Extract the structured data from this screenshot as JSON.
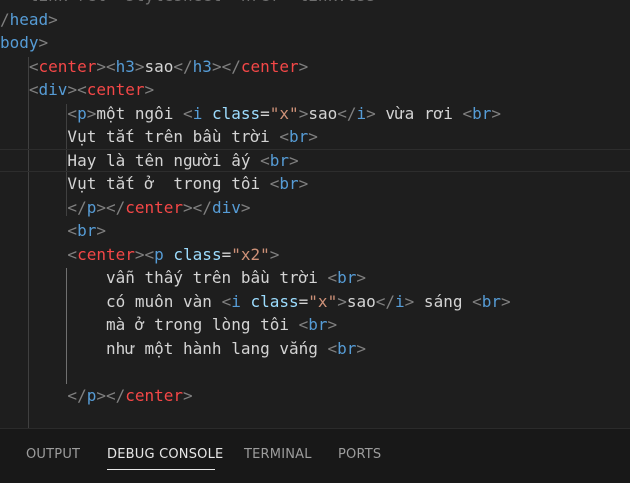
{
  "editor": {
    "lines": [
      [
        {
          "c": "cut",
          "t": "  <link rel=\"stylesheet\" href=\"link.css\">"
        }
      ],
      [
        {
          "c": "gray",
          "t": "/"
        },
        {
          "c": "tag",
          "t": "head"
        },
        {
          "c": "gray",
          "t": ">"
        }
      ],
      [
        {
          "c": "tag",
          "t": "body"
        },
        {
          "c": "gray",
          "t": ">"
        }
      ],
      [
        {
          "c": "gray",
          "t": "   <"
        },
        {
          "c": "red",
          "t": "center"
        },
        {
          "c": "gray",
          "t": "><"
        },
        {
          "c": "tag",
          "t": "h3"
        },
        {
          "c": "gray",
          "t": ">"
        },
        {
          "c": "txt",
          "t": "sao"
        },
        {
          "c": "gray",
          "t": "</"
        },
        {
          "c": "tag",
          "t": "h3"
        },
        {
          "c": "gray",
          "t": "></"
        },
        {
          "c": "red",
          "t": "center"
        },
        {
          "c": "gray",
          "t": ">"
        }
      ],
      [
        {
          "c": "gray",
          "t": "   <"
        },
        {
          "c": "tag",
          "t": "div"
        },
        {
          "c": "gray",
          "t": "><"
        },
        {
          "c": "red",
          "t": "center"
        },
        {
          "c": "gray",
          "t": ">"
        }
      ],
      [
        {
          "c": "gray",
          "t": "       <"
        },
        {
          "c": "tag",
          "t": "p"
        },
        {
          "c": "gray",
          "t": ">"
        },
        {
          "c": "txt",
          "t": "một ngôi "
        },
        {
          "c": "gray",
          "t": "<"
        },
        {
          "c": "tag",
          "t": "i"
        },
        {
          "c": "txt",
          "t": " "
        },
        {
          "c": "attr",
          "t": "class"
        },
        {
          "c": "txt",
          "t": "="
        },
        {
          "c": "str",
          "t": "\"x\""
        },
        {
          "c": "gray",
          "t": ">"
        },
        {
          "c": "txt",
          "t": "sao"
        },
        {
          "c": "gray",
          "t": "</"
        },
        {
          "c": "tag",
          "t": "i"
        },
        {
          "c": "gray",
          "t": ">"
        },
        {
          "c": "txt",
          "t": " vừa rơi "
        },
        {
          "c": "gray",
          "t": "<"
        },
        {
          "c": "tag",
          "t": "br"
        },
        {
          "c": "gray",
          "t": ">"
        }
      ],
      [
        {
          "c": "txt",
          "t": "       Vụt tắt trên bầu trời "
        },
        {
          "c": "gray",
          "t": "<"
        },
        {
          "c": "tag",
          "t": "br"
        },
        {
          "c": "gray",
          "t": ">"
        }
      ],
      [
        {
          "c": "txt",
          "t": "       Hay là tên người ấy "
        },
        {
          "c": "gray",
          "t": "<"
        },
        {
          "c": "tag",
          "t": "br"
        },
        {
          "c": "gray",
          "t": ">"
        }
      ],
      [
        {
          "c": "txt",
          "t": "       Vụt tắt ở  trong tôi "
        },
        {
          "c": "gray",
          "t": "<"
        },
        {
          "c": "tag",
          "t": "br"
        },
        {
          "c": "gray",
          "t": ">"
        }
      ],
      [
        {
          "c": "gray",
          "t": "       </"
        },
        {
          "c": "tag",
          "t": "p"
        },
        {
          "c": "gray",
          "t": "></"
        },
        {
          "c": "red",
          "t": "center"
        },
        {
          "c": "gray",
          "t": "></"
        },
        {
          "c": "tag",
          "t": "div"
        },
        {
          "c": "gray",
          "t": ">"
        }
      ],
      [
        {
          "c": "gray",
          "t": "       <"
        },
        {
          "c": "tag",
          "t": "br"
        },
        {
          "c": "gray",
          "t": ">"
        }
      ],
      [
        {
          "c": "gray",
          "t": "       <"
        },
        {
          "c": "red",
          "t": "center"
        },
        {
          "c": "gray",
          "t": "><"
        },
        {
          "c": "tag",
          "t": "p"
        },
        {
          "c": "txt",
          "t": " "
        },
        {
          "c": "attr",
          "t": "class"
        },
        {
          "c": "txt",
          "t": "="
        },
        {
          "c": "str",
          "t": "\"x2\""
        },
        {
          "c": "gray",
          "t": ">"
        }
      ],
      [
        {
          "c": "txt",
          "t": "           vẫn thấy trên bầu trời "
        },
        {
          "c": "gray",
          "t": "<"
        },
        {
          "c": "tag",
          "t": "br"
        },
        {
          "c": "gray",
          "t": ">"
        }
      ],
      [
        {
          "c": "txt",
          "t": "           có muôn vàn "
        },
        {
          "c": "gray",
          "t": "<"
        },
        {
          "c": "tag",
          "t": "i"
        },
        {
          "c": "txt",
          "t": " "
        },
        {
          "c": "attr",
          "t": "class"
        },
        {
          "c": "txt",
          "t": "="
        },
        {
          "c": "str",
          "t": "\"x\""
        },
        {
          "c": "gray",
          "t": ">"
        },
        {
          "c": "txt",
          "t": "sao"
        },
        {
          "c": "gray",
          "t": "</"
        },
        {
          "c": "tag",
          "t": "i"
        },
        {
          "c": "gray",
          "t": ">"
        },
        {
          "c": "txt",
          "t": " sáng "
        },
        {
          "c": "gray",
          "t": "<"
        },
        {
          "c": "tag",
          "t": "br"
        },
        {
          "c": "gray",
          "t": ">"
        }
      ],
      [
        {
          "c": "txt",
          "t": "           mà ở trong lòng tôi "
        },
        {
          "c": "gray",
          "t": "<"
        },
        {
          "c": "tag",
          "t": "br"
        },
        {
          "c": "gray",
          "t": ">"
        }
      ],
      [
        {
          "c": "txt",
          "t": "           như một hành lang vắng "
        },
        {
          "c": "gray",
          "t": "<"
        },
        {
          "c": "tag",
          "t": "br"
        },
        {
          "c": "gray",
          "t": ">"
        }
      ],
      [
        {
          "c": "txt",
          "t": ""
        }
      ],
      [
        {
          "c": "gray",
          "t": "       </"
        },
        {
          "c": "tag",
          "t": "p"
        },
        {
          "c": "gray",
          "t": "></"
        },
        {
          "c": "red",
          "t": "center"
        },
        {
          "c": "gray",
          "t": ">"
        }
      ],
      [
        {
          "c": "txt",
          "t": ""
        }
      ]
    ]
  },
  "panel": {
    "tabs": [
      {
        "label": "OUTPUT"
      },
      {
        "label": "DEBUG CONSOLE"
      },
      {
        "label": "TERMINAL"
      },
      {
        "label": "PORTS"
      }
    ]
  },
  "colors": {
    "editor_bg": "#1e1e1e",
    "tag": "#569cd6",
    "tag_special": "#f44747",
    "attribute": "#9cdcfe",
    "string": "#ce9178",
    "punctuation": "#808080",
    "text": "#d4d4d4",
    "panel_bg": "#181818"
  }
}
